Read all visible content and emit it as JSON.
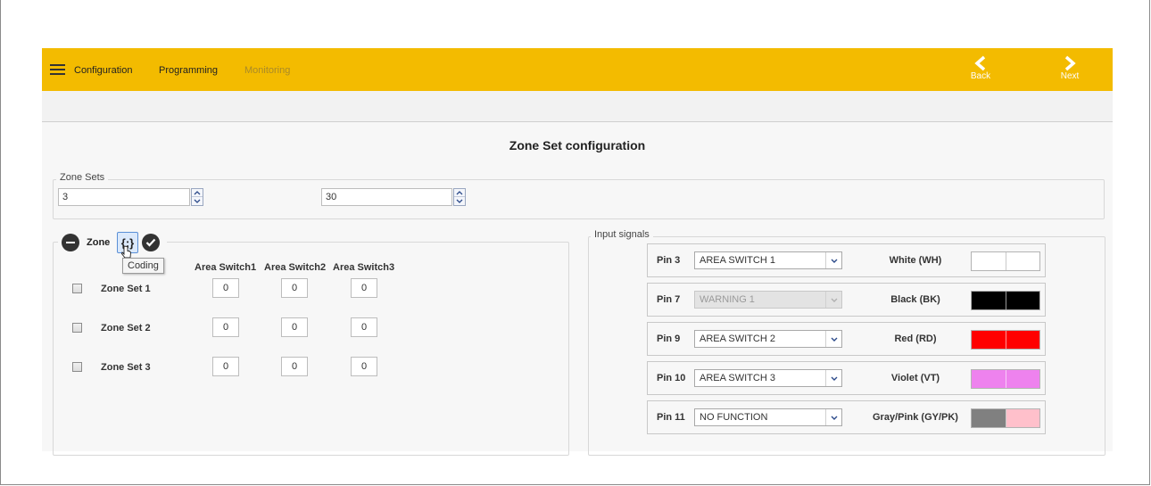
{
  "nav": {
    "items": [
      {
        "label": "Configuration"
      },
      {
        "label": "Programming"
      },
      {
        "label": "Monitoring"
      }
    ],
    "back_label": "Back",
    "next_label": "Next"
  },
  "page_title": "Zone Set configuration",
  "zone_sets": {
    "legend": "Zone Sets",
    "count_value": "3",
    "second_value": "30"
  },
  "zone": {
    "legend": "Zone",
    "tooltip": "Coding",
    "coding_symbol": "{;}",
    "columns": [
      "Area Switch1",
      "Area Switch2",
      "Area Switch3"
    ],
    "rows": [
      {
        "label": "Zone Set 1",
        "values": [
          "0",
          "0",
          "0"
        ]
      },
      {
        "label": "Zone Set 2",
        "values": [
          "0",
          "0",
          "0"
        ]
      },
      {
        "label": "Zone Set 3",
        "values": [
          "0",
          "0",
          "0"
        ]
      }
    ]
  },
  "input_signals": {
    "legend": "Input signals",
    "pins": [
      {
        "pin": "Pin 3",
        "function": "AREA SWITCH 1",
        "disabled": false,
        "color_name": "White (WH)",
        "color_a": "#ffffff",
        "color_b": "#ffffff"
      },
      {
        "pin": "Pin 7",
        "function": "WARNING 1",
        "disabled": true,
        "color_name": "Black (BK)",
        "color_a": "#000000",
        "color_b": "#000000"
      },
      {
        "pin": "Pin 9",
        "function": "AREA SWITCH 2",
        "disabled": false,
        "color_name": "Red (RD)",
        "color_a": "#ff0000",
        "color_b": "#ff0000"
      },
      {
        "pin": "Pin 10",
        "function": "AREA SWITCH 3",
        "disabled": false,
        "color_name": "Violet (VT)",
        "color_a": "#ee82ee",
        "color_b": "#ee82ee"
      },
      {
        "pin": "Pin 11",
        "function": "NO FUNCTION",
        "disabled": false,
        "color_name": "Gray/Pink (GY/PK)",
        "color_a": "#808080",
        "color_b": "#ffc0cb"
      }
    ]
  },
  "colors": {
    "accent": "#f3bb00",
    "panel_bg": "#f7f7f7"
  }
}
